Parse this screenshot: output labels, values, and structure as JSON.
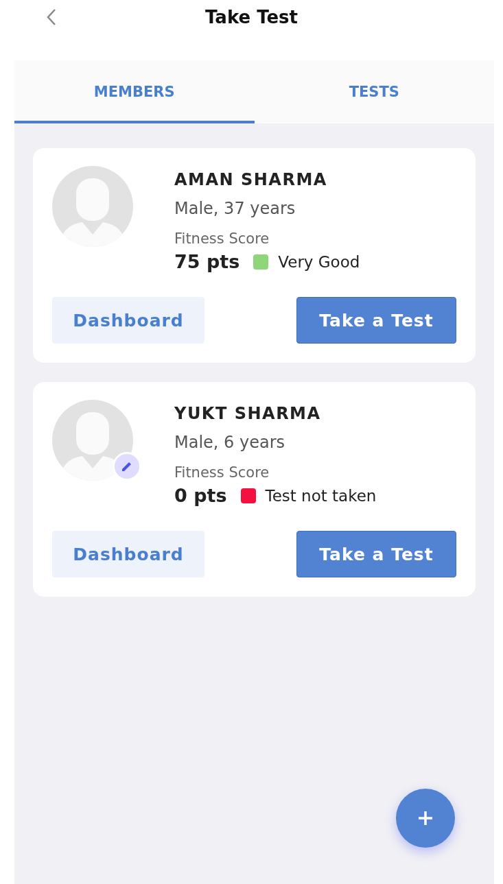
{
  "header": {
    "title": "Take Test"
  },
  "tabs": [
    {
      "label": "MEMBERS",
      "selected": true
    },
    {
      "label": "TESTS",
      "selected": false
    }
  ],
  "members": [
    {
      "name": "AMAN SHARMA",
      "details": "Male, 37 years",
      "score_label": "Fitness Score",
      "score": "75 pts",
      "status": "Very Good",
      "color": "#8fd67a",
      "editable": false,
      "buttons": [
        "Dashboard",
        "Take a Test"
      ]
    },
    {
      "name": "YUKT SHARMA",
      "details": "Male, 6 years",
      "score_label": "Fitness Score",
      "score": "0 pts",
      "status": "Test not taken",
      "color": "#f5113f",
      "editable": true,
      "buttons": [
        "Dashboard",
        "Take a Test"
      ]
    }
  ]
}
